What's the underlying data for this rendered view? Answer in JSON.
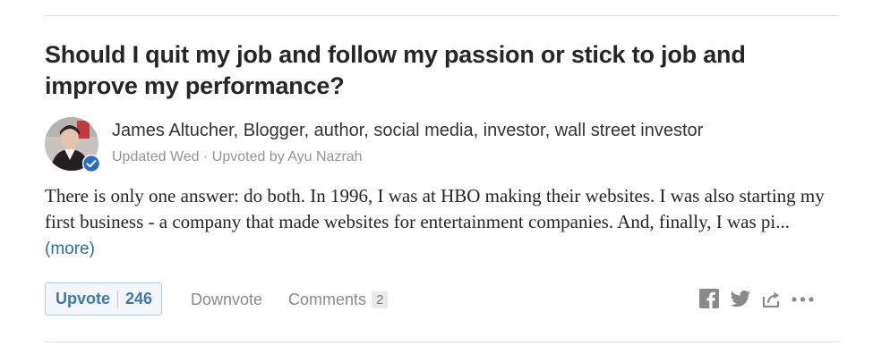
{
  "question": {
    "title": "Should I quit my job and follow my passion or stick to job and improve my performance?"
  },
  "answer": {
    "author": "James Altucher, Blogger, author, social media, investor, wall street investor",
    "meta": "Updated Wed · Upvoted by Ayu Nazrah",
    "text": "There is only one answer: do both. In 1996, I was at HBO making their websites. I was also starting my first business - a company that made websites for entertainment companies. And, finally, I was pi...",
    "more_label": "(more)"
  },
  "actions": {
    "upvote_label": "Upvote",
    "upvote_count": "246",
    "downvote_label": "Downvote",
    "comments_label": "Comments",
    "comments_count": "2"
  },
  "share": {
    "icons": [
      "facebook-icon",
      "twitter-icon",
      "share-arrow-icon",
      "more-options-icon"
    ]
  },
  "colors": {
    "accent_blue": "#3e78b4",
    "link_blue": "#2b6dad",
    "badge_blue": "#2b6dc2",
    "muted_gray": "#8a8a8a"
  }
}
